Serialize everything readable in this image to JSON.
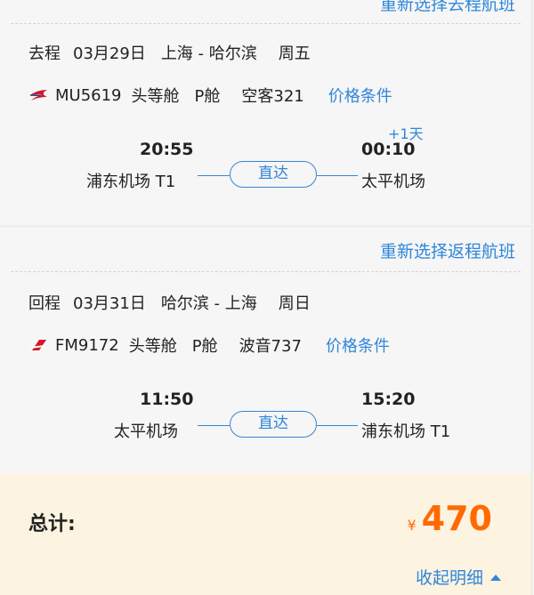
{
  "outbound": {
    "reselect_label": "重新选择去程航班",
    "leg_label": "去程",
    "date": "03月29日",
    "route": "上海 - 哈尔滨",
    "weekday": "周五",
    "airline_icon": "china-eastern-logo",
    "flight_no": "MU5619",
    "cabin": "头等舱",
    "cabin_class": "P舱",
    "aircraft": "空客321",
    "price_terms_label": "价格条件",
    "depart_time": "20:55",
    "arrive_time": "00:10",
    "next_day": "+1天",
    "depart_airport": "浦东机场 T1",
    "arrive_airport": "太平机场",
    "direct_label": "直达"
  },
  "return": {
    "reselect_label": "重新选择返程航班",
    "leg_label": "回程",
    "date": "03月31日",
    "route": "哈尔滨 - 上海",
    "weekday": "周日",
    "airline_icon": "shanghai-airlines-logo",
    "flight_no": "FM9172",
    "cabin": "头等舱",
    "cabin_class": "P舱",
    "aircraft": "波音737",
    "price_terms_label": "价格条件",
    "depart_time": "11:50",
    "arrive_time": "15:20",
    "depart_airport": "太平机场",
    "arrive_airport": "浦东机场 T1",
    "direct_label": "直达"
  },
  "summary": {
    "total_label": "总计:",
    "currency": "¥",
    "amount": "470",
    "collapse_label": "收起明细"
  },
  "colors": {
    "link": "#2f86d9",
    "price": "#ff6a00",
    "summary_bg": "#fdf3e1"
  }
}
